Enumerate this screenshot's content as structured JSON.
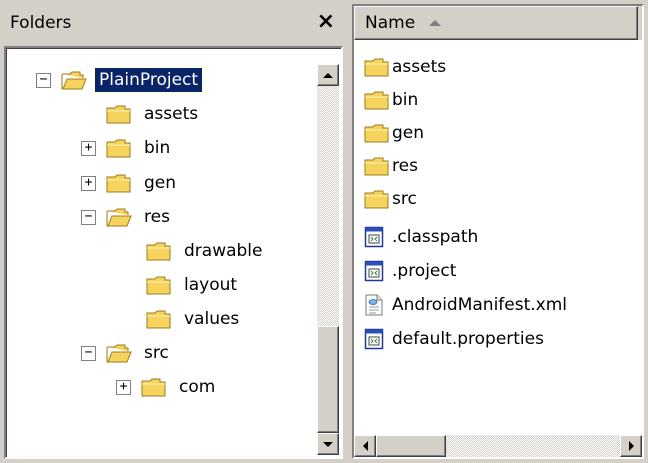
{
  "folders_pane": {
    "title": "Folders",
    "close_label": "×",
    "tree": [
      {
        "label": "PlainProject",
        "expander": "−",
        "selected": true
      },
      {
        "label": "assets",
        "expander": ""
      },
      {
        "label": "bin",
        "expander": "+"
      },
      {
        "label": "gen",
        "expander": "+"
      },
      {
        "label": "res",
        "expander": "−"
      },
      {
        "label": "drawable",
        "expander": ""
      },
      {
        "label": "layout",
        "expander": ""
      },
      {
        "label": "values",
        "expander": ""
      },
      {
        "label": "src",
        "expander": "−"
      },
      {
        "label": "com",
        "expander": "+"
      }
    ]
  },
  "files_pane": {
    "column_header": "Name",
    "sort": "ascending",
    "items": [
      {
        "label": "assets",
        "icon": "folder-icon"
      },
      {
        "label": "bin",
        "icon": "folder-icon"
      },
      {
        "label": "gen",
        "icon": "folder-icon"
      },
      {
        "label": "res",
        "icon": "folder-icon"
      },
      {
        "label": "src",
        "icon": "folder-icon"
      },
      {
        "label": ".classpath",
        "icon": "document-icon"
      },
      {
        "label": ".project",
        "icon": "document-icon"
      },
      {
        "label": "AndroidManifest.xml",
        "icon": "xml-file-icon"
      },
      {
        "label": "default.properties",
        "icon": "document-icon"
      }
    ]
  },
  "colors": {
    "window_bg": "#d4d0c8",
    "selection_bg": "#0a246a",
    "folder_yellow": "#f5d35c"
  }
}
